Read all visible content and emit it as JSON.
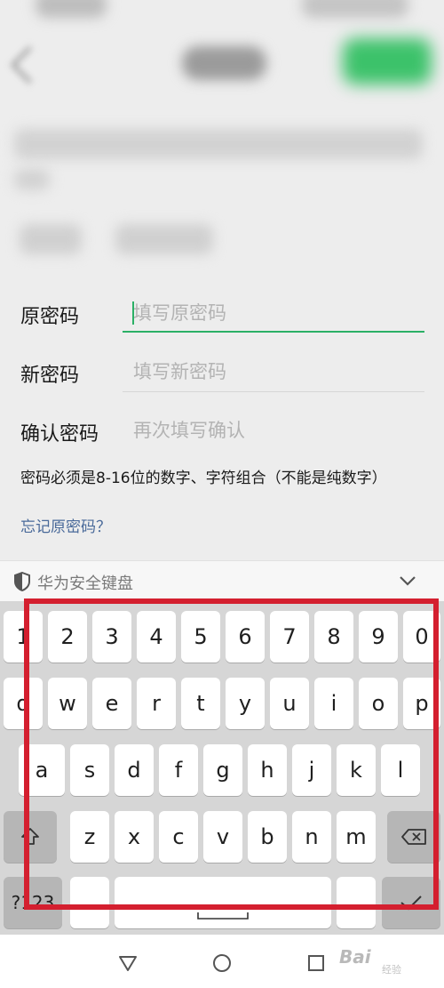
{
  "form": {
    "rows": [
      {
        "label": "原密码",
        "placeholder": "填写原密码"
      },
      {
        "label": "新密码",
        "placeholder": "填写新密码"
      },
      {
        "label": "确认密码",
        "placeholder": "再次填写确认"
      }
    ],
    "hint": "密码必须是8-16位的数字、字符组合（不能是纯数字）",
    "forgot_link": "忘记原密码？"
  },
  "keyboard": {
    "title": "华为安全键盘",
    "row1": [
      "1",
      "2",
      "3",
      "4",
      "5",
      "6",
      "7",
      "8",
      "9",
      "0"
    ],
    "row2": [
      "q",
      "w",
      "e",
      "r",
      "t",
      "y",
      "u",
      "i",
      "o",
      "p"
    ],
    "row3": [
      "a",
      "s",
      "d",
      "f",
      "g",
      "h",
      "j",
      "k",
      "l"
    ],
    "row4": [
      "z",
      "x",
      "c",
      "v",
      "b",
      "n",
      "m"
    ],
    "symbols_key": "?123",
    "icons": {
      "shield": "shield-icon",
      "collapse": "chevron-down-icon",
      "shift": "shift-icon",
      "backspace": "backspace-icon",
      "confirm": "checkmark-icon"
    }
  },
  "watermark": {
    "text": "Bai",
    "sub": "经验"
  },
  "colors": {
    "accent_green": "#2bb066",
    "link_blue": "#4a6a9a",
    "highlight_red": "#d41f2f"
  }
}
